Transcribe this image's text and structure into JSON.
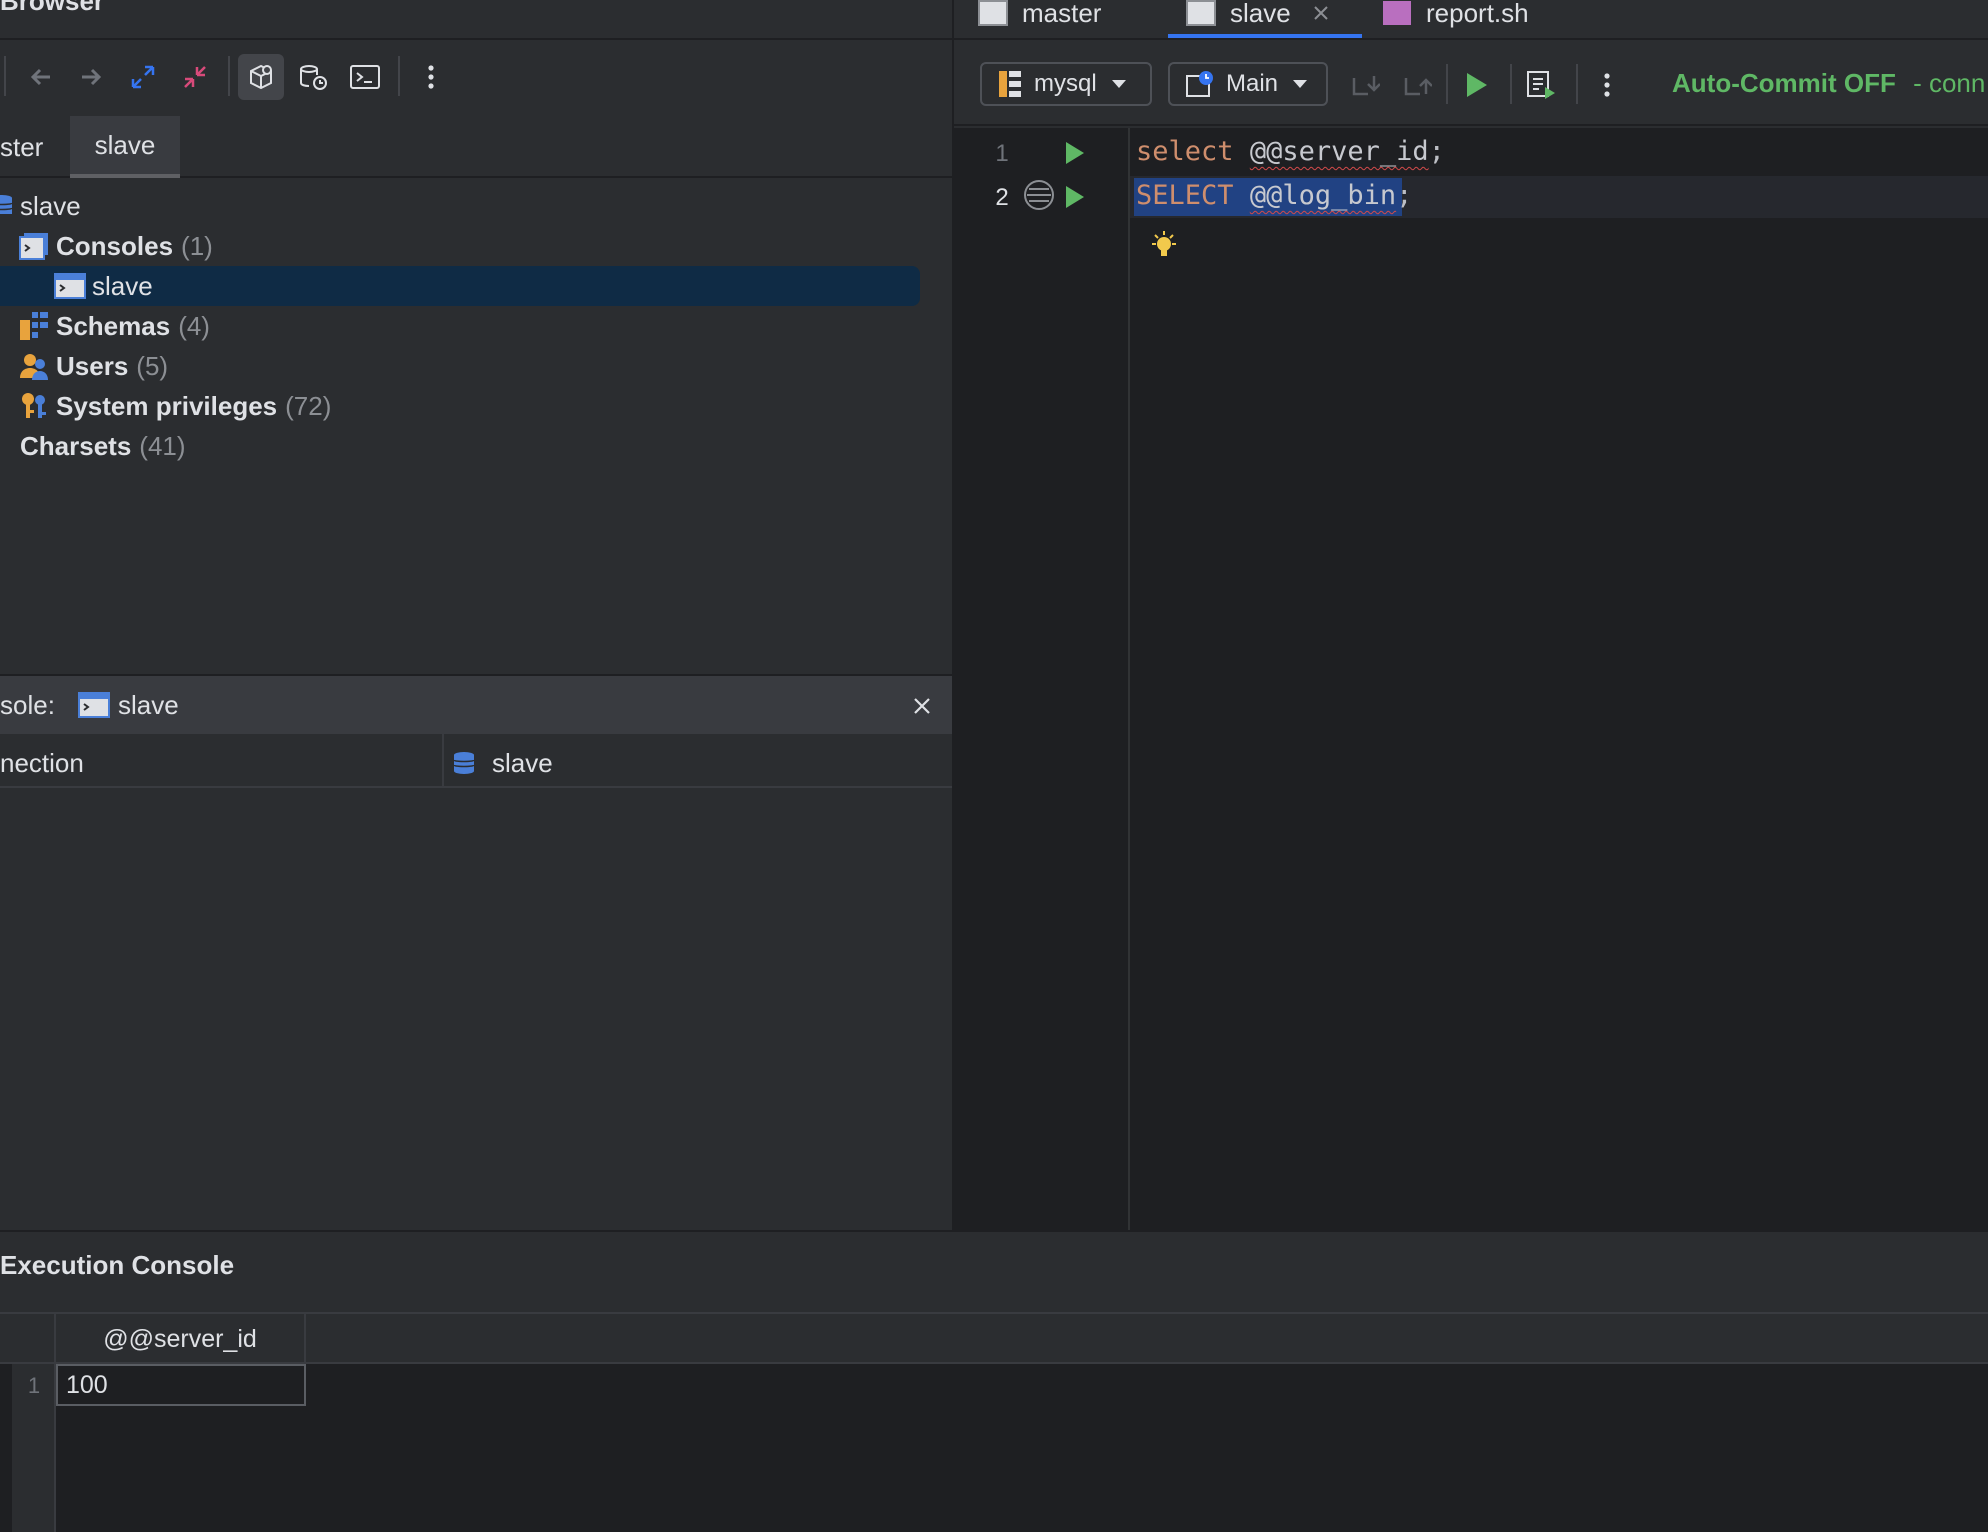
{
  "left_panel": {
    "title": "Browser",
    "connection_tabs": [
      {
        "label": "ster"
      },
      {
        "label": "slave"
      }
    ],
    "tree": [
      {
        "label": "slave",
        "count": ""
      },
      {
        "label": "Consoles",
        "count": "(1)"
      },
      {
        "label": "slave",
        "count": ""
      },
      {
        "label": "Schemas",
        "count": "(4)"
      },
      {
        "label": "Users",
        "count": "(5)"
      },
      {
        "label": "System privileges",
        "count": "(72)"
      },
      {
        "label": "Charsets",
        "count": "(41)"
      }
    ],
    "console_bar": {
      "prefix": "sole:",
      "name": "slave"
    },
    "connection_row": {
      "label": "nection",
      "value": "slave"
    }
  },
  "editor_tabs": [
    {
      "label": "master"
    },
    {
      "label": "slave"
    },
    {
      "label": "report.sh"
    }
  ],
  "editor_toolbar": {
    "datasource": "mysql",
    "session": "Main",
    "autocommit": "Auto-Commit OFF",
    "autocommit_suffix": "- conn"
  },
  "code": {
    "lines": [
      {
        "number": "1",
        "keyword": "select",
        "rest": "@@server_id",
        "end": ";"
      },
      {
        "number": "2",
        "keyword": "SELECT",
        "rest": "@@log_bin",
        "end": ";"
      }
    ]
  },
  "execution_console": {
    "title": "Execution Console",
    "columns": [
      "@@server_id"
    ],
    "rows": [
      {
        "index": "1",
        "values": [
          "100"
        ]
      }
    ]
  },
  "colors": {
    "accent": "#3574f0",
    "run_green": "#5fb865",
    "autocommit_green": "#5fb865",
    "selection": "#0f2b45"
  }
}
